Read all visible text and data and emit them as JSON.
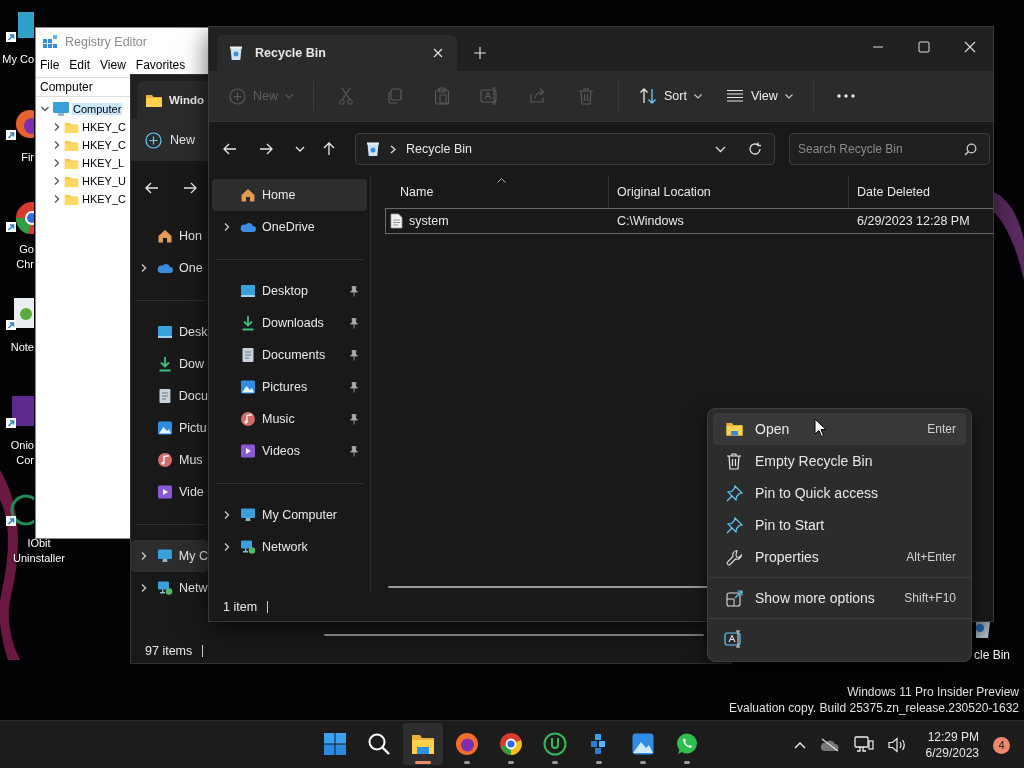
{
  "desktop": {
    "icons": [
      {
        "kind": "computer",
        "lines": [
          "My Co"
        ]
      },
      {
        "kind": "firefox",
        "lines": [
          "Fir"
        ]
      },
      {
        "kind": "chrome",
        "lines": [
          "Go",
          "Chr"
        ]
      },
      {
        "kind": "notepad",
        "lines": [
          "Note"
        ]
      },
      {
        "kind": "onion",
        "lines": [
          "Onio",
          "Cor"
        ]
      },
      {
        "kind": "iobit",
        "lines": [
          "IObit",
          "Uninstaller"
        ]
      }
    ],
    "recycle_bin_label": "cle Bin",
    "watermark": [
      "Windows 11 Pro Insider Preview",
      "Evaluation copy. Build 25375.zn_release.230520-1632"
    ]
  },
  "registry_editor": {
    "title": "Registry Editor",
    "menu": [
      "File",
      "Edit",
      "View",
      "Favorites"
    ],
    "address": "Computer",
    "tree": [
      {
        "label": "Computer",
        "expanded": true,
        "selected": true,
        "children": [
          {
            "label": "HKEY_C",
            "expanded": false,
            "selected": false
          },
          {
            "label": "HKEY_C",
            "expanded": false,
            "selected": false
          },
          {
            "label": "HKEY_L",
            "expanded": false,
            "selected": false
          },
          {
            "label": "HKEY_U",
            "expanded": false,
            "selected": false
          },
          {
            "label": "HKEY_C",
            "expanded": false,
            "selected": false
          }
        ]
      }
    ]
  },
  "back_explorer": {
    "tab": "Windo",
    "new_label": "New",
    "sidebar": [
      [
        {
          "kind": "home",
          "label": "Hon",
          "expandable": false,
          "selected": false
        },
        {
          "kind": "onedrive",
          "label": "One",
          "expandable": true,
          "selected": false
        }
      ],
      [
        {
          "kind": "desktop",
          "label": "Desk",
          "expandable": false,
          "selected": false
        },
        {
          "kind": "downloads",
          "label": "Dow",
          "expandable": false,
          "selected": false
        },
        {
          "kind": "documents",
          "label": "Docu",
          "expandable": false,
          "selected": false
        },
        {
          "kind": "pictures",
          "label": "Pictu",
          "expandable": false,
          "selected": false
        },
        {
          "kind": "music",
          "label": "Mus",
          "expandable": false,
          "selected": false
        },
        {
          "kind": "videos",
          "label": "Vide",
          "expandable": false,
          "selected": false
        }
      ],
      [
        {
          "kind": "computer",
          "label": "My C",
          "expandable": true,
          "selected": true
        },
        {
          "kind": "network",
          "label": "Netw",
          "expandable": true,
          "selected": false
        }
      ]
    ],
    "status": "97 items"
  },
  "explorer": {
    "tab": "Recycle Bin",
    "toolbar": [
      [
        {
          "kind": "new",
          "label": "New",
          "disabled": true
        }
      ],
      [
        {
          "kind": "cut",
          "disabled": true
        },
        {
          "kind": "copy",
          "disabled": true
        },
        {
          "kind": "paste",
          "disabled": true
        },
        {
          "kind": "rename",
          "disabled": true
        },
        {
          "kind": "share",
          "disabled": true
        },
        {
          "kind": "delete",
          "disabled": true
        }
      ],
      [
        {
          "kind": "sort",
          "label": "Sort",
          "disabled": false
        },
        {
          "kind": "view",
          "label": "View",
          "disabled": false
        }
      ],
      [
        {
          "kind": "more",
          "disabled": false
        }
      ]
    ],
    "address": "Recycle Bin",
    "search": {
      "placeholder": "Search Recycle Bin"
    },
    "sidebar": [
      [
        {
          "kind": "home",
          "label": "Home",
          "expandable": false,
          "selected": true,
          "pinned": false
        },
        {
          "kind": "onedrive",
          "label": "OneDrive",
          "expandable": true,
          "selected": false,
          "pinned": false
        }
      ],
      [
        {
          "kind": "desktop",
          "label": "Desktop",
          "expandable": false,
          "selected": false,
          "pinned": true
        },
        {
          "kind": "downloads",
          "label": "Downloads",
          "expandable": false,
          "selected": false,
          "pinned": true
        },
        {
          "kind": "documents",
          "label": "Documents",
          "expandable": false,
          "selected": false,
          "pinned": true
        },
        {
          "kind": "pictures",
          "label": "Pictures",
          "expandable": false,
          "selected": false,
          "pinned": true
        },
        {
          "kind": "music",
          "label": "Music",
          "expandable": false,
          "selected": false,
          "pinned": true
        },
        {
          "kind": "videos",
          "label": "Videos",
          "expandable": false,
          "selected": false,
          "pinned": true
        }
      ],
      [
        {
          "kind": "computer",
          "label": "My Computer",
          "expandable": true,
          "selected": false,
          "pinned": false
        },
        {
          "kind": "network",
          "label": "Network",
          "expandable": true,
          "selected": false,
          "pinned": false
        }
      ]
    ],
    "columns": [
      {
        "label": "Name",
        "sorted": true
      },
      {
        "label": "Original Location",
        "sorted": false
      },
      {
        "label": "Date Deleted",
        "sorted": false
      }
    ],
    "rows": [
      {
        "cells": [
          "system",
          "C:\\Windows",
          "6/29/2023 12:28 PM"
        ],
        "focused": true
      }
    ],
    "status": "1 item"
  },
  "context_menu": {
    "sections": [
      [
        {
          "kind": "open",
          "label": "Open",
          "shortcut": "Enter",
          "hovered": true
        },
        {
          "kind": "empty",
          "label": "Empty Recycle Bin",
          "hovered": false
        },
        {
          "kind": "pin",
          "label": "Pin to Quick access",
          "hovered": false
        },
        {
          "kind": "pin",
          "label": "Pin to Start",
          "hovered": false
        },
        {
          "kind": "properties",
          "label": "Properties",
          "shortcut": "Alt+Enter",
          "hovered": false
        }
      ],
      [
        {
          "kind": "more_options",
          "label": "Show more options",
          "shortcut": "Shift+F10",
          "hovered": false
        }
      ],
      [
        {
          "kind": "rename",
          "hovered": false
        }
      ]
    ]
  },
  "taskbar": {
    "apps": [
      {
        "kind": "start",
        "running": false,
        "active": false
      },
      {
        "kind": "search",
        "running": false,
        "active": false
      },
      {
        "kind": "explorer",
        "running": true,
        "active": true
      },
      {
        "kind": "firefox",
        "running": true,
        "active": false
      },
      {
        "kind": "chrome",
        "running": true,
        "active": false
      },
      {
        "kind": "torrent",
        "running": true,
        "active": false
      },
      {
        "kind": "cubes",
        "running": true,
        "active": false
      },
      {
        "kind": "photos",
        "running": true,
        "active": false
      },
      {
        "kind": "whatsapp",
        "running": true,
        "active": false
      }
    ],
    "time": "12:29 PM",
    "date": "6/29/2023",
    "notifications": "4"
  }
}
